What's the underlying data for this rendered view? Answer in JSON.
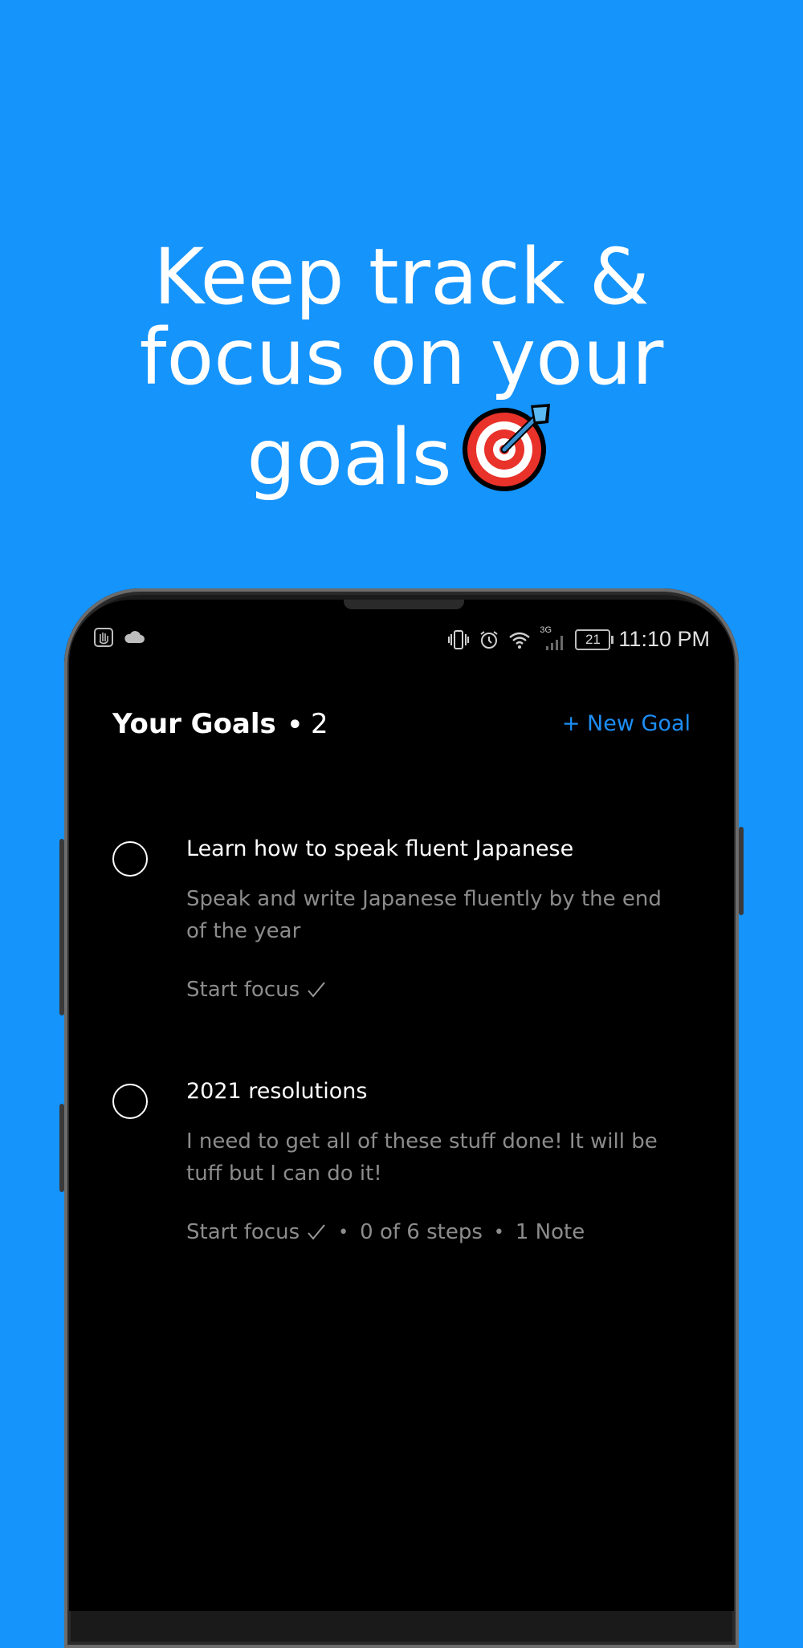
{
  "promo": {
    "line1": "Keep track &",
    "line2": "focus on your",
    "line3": "goals",
    "emoji_icon": "direct-hit-target-icon"
  },
  "status_bar": {
    "left_icons": [
      "gesture-hand-icon",
      "cloud-icon"
    ],
    "right_icons": [
      "vibrate-icon",
      "alarm-icon",
      "wifi-icon",
      "signal-3g-icon"
    ],
    "network": "3G",
    "battery": "21",
    "time": "11:10 PM"
  },
  "header": {
    "title": "Your Goals",
    "separator": "•",
    "count": "2",
    "new_goal_label": "+ New Goal"
  },
  "goals": [
    {
      "title": "Learn how to speak fluent Japanese",
      "description": "Speak and write Japanese fluently by the end of the year",
      "start_focus": "Start focus",
      "steps": "",
      "notes": ""
    },
    {
      "title": "2021 resolutions",
      "description": "I need to get all of these stuff done! It will be tuff but I can do it!",
      "start_focus": "Start focus",
      "steps": "0 of 6 steps",
      "notes": "1 Note"
    }
  ],
  "colors": {
    "background": "#1594fc",
    "accent": "#1d8ef5",
    "screen": "#000000",
    "muted_text": "#8c8c8c"
  }
}
